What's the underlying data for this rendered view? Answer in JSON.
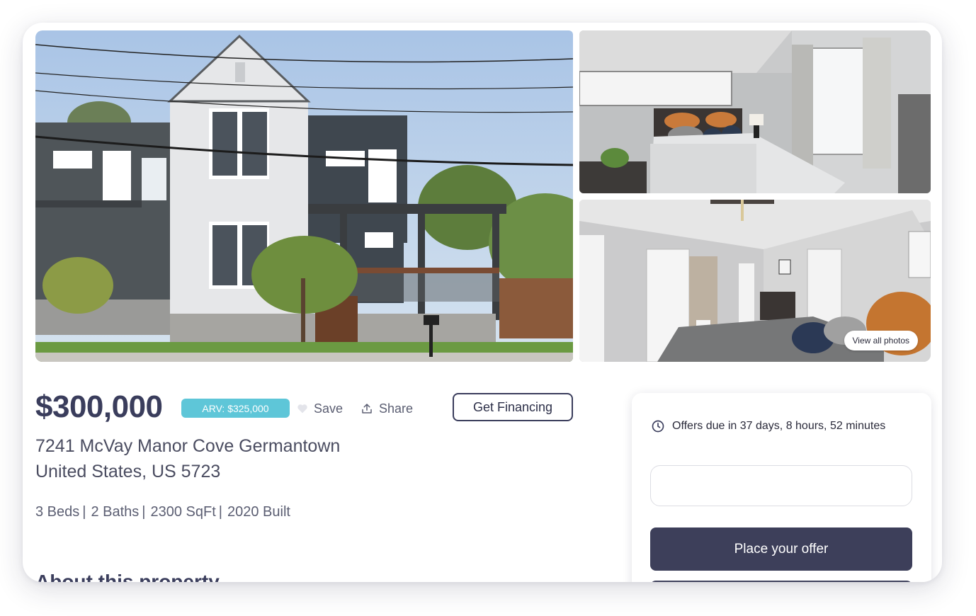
{
  "listing": {
    "price": "$300,000",
    "arv_badge": "ARV: $325,000",
    "save_label": "Save",
    "share_label": "Share",
    "financing_label": "Get Financing",
    "address_line1": "7241 McVay Manor Cove Germantown",
    "address_line2": "United States, US 5723",
    "specs": [
      "3 Beds",
      "2 Baths",
      "2300 SqFt",
      "2020 Built"
    ],
    "about_heading": "About this property"
  },
  "gallery": {
    "view_all_label": "View all photos"
  },
  "offer_panel": {
    "deadline": "Offers due in 37 days, 8 hours, 52 minutes",
    "input_value": "",
    "place_offer_label": "Place your offer"
  },
  "colors": {
    "primary": "#3d3f5a",
    "arv_badge": "#5ec6d8",
    "text_muted": "#5b5e72"
  }
}
